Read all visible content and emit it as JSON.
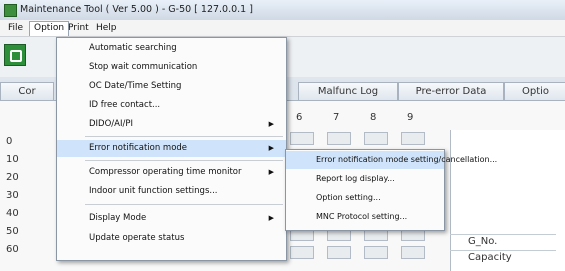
{
  "window": {
    "title": "Maintenance Tool ( Ver 5.00 ) - G-50 [ 127.0.0.1 ]"
  },
  "menubar": {
    "items": [
      "File",
      "Option",
      "Print",
      "Help"
    ]
  },
  "tabs": [
    {
      "label": "Cor"
    },
    {
      "label": "Malfunc Log"
    },
    {
      "label": "Pre-error Data"
    },
    {
      "label": "Optio"
    }
  ],
  "grid": {
    "columns": [
      "6",
      "7",
      "8",
      "9"
    ],
    "rows": [
      "0",
      "10",
      "20",
      "30",
      "40",
      "50",
      "60"
    ]
  },
  "side_table": {
    "rows": [
      "G_No.",
      "Capacity"
    ]
  },
  "option_menu": {
    "items": [
      {
        "label": "Automatic searching"
      },
      {
        "label": "Stop wait communication"
      },
      {
        "label": "OC Date/Time Setting"
      },
      {
        "label": "ID free contact..."
      },
      {
        "label": "DIDO/AI/PI"
      },
      {
        "label": "Error notification mode"
      },
      {
        "label": "Compressor operating time monitor"
      },
      {
        "label": "Indoor unit function settings..."
      },
      {
        "label": "Display Mode"
      },
      {
        "label": "Update operate status"
      }
    ]
  },
  "submenu": {
    "items": [
      {
        "label": "Error notification mode setting/cancellation..."
      },
      {
        "label": "Report log display..."
      },
      {
        "label": "Option setting..."
      },
      {
        "label": "MNC Protocol setting..."
      }
    ]
  },
  "icons": {
    "app": "maintenance-tool-icon",
    "toolbar": "refresh-icon",
    "submenu_arrow": "triangle-right-icon"
  }
}
